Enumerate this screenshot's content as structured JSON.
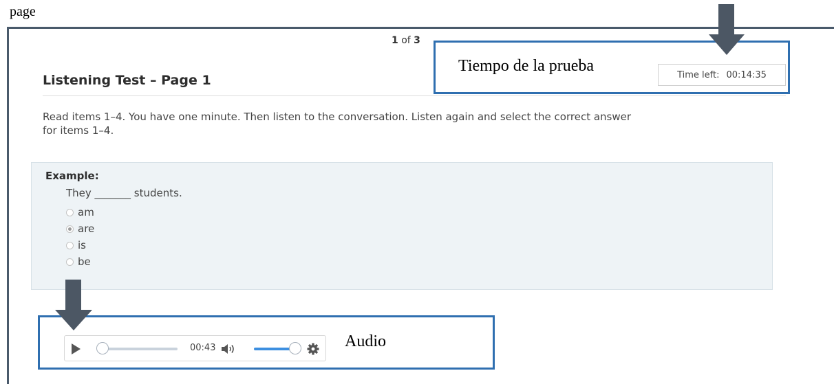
{
  "top_label": "page",
  "pagination": {
    "current": "1",
    "of_label": "of",
    "total": "3"
  },
  "page_title": "Listening Test – Page 1",
  "timer": {
    "label": "Time left:",
    "value": "00:14:35"
  },
  "instructions": "Read items 1–4. You have one minute. Then listen to the conversation. Listen again and select the correct answer for items 1–4.",
  "example": {
    "label": "Example:",
    "question": "They _______ students.",
    "options": [
      {
        "label": "am",
        "selected": false
      },
      {
        "label": "are",
        "selected": true
      },
      {
        "label": "is",
        "selected": false
      },
      {
        "label": "be",
        "selected": false
      }
    ]
  },
  "audio_player": {
    "time": "00:43",
    "seek_progress": 0,
    "volume": 1.0,
    "play_icon": "play-icon",
    "volume_icon": "volume-icon",
    "settings_icon": "gear-icon"
  },
  "annotations": {
    "timer_callout": "Tiempo de la prueba",
    "audio_callout": "Audio",
    "arrow_color": "#4c5764",
    "box_color": "#2f6fb0"
  }
}
